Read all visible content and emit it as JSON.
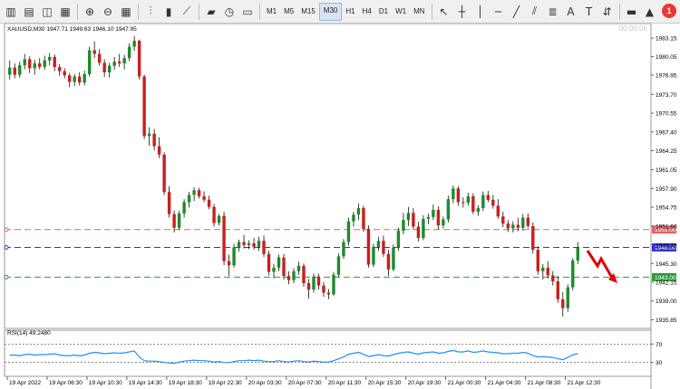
{
  "toolbar": {
    "timeframes": [
      "M1",
      "M5",
      "M15",
      "M30",
      "H1",
      "H4",
      "D1",
      "W1",
      "MN"
    ],
    "active_timeframe": "M30",
    "notification_count": "1"
  },
  "chart_data": {
    "type": "candlestick",
    "symbol_info": "XAUUSD,M30  1947.71 1949.63 1946.10 1947.95",
    "timer": "00:00:06",
    "price_axis": [
      "1983.15",
      "1980.05",
      "1976.95",
      "1973.70",
      "1970.55",
      "1967.40",
      "1964.25",
      "1961.05",
      "1957.90",
      "1954.75",
      "1951.60",
      "1948.40",
      "1945.30",
      "1942.15",
      "1939.00",
      "1935.85"
    ],
    "ylim": [
      1934.4,
      1985.6
    ],
    "time_axis": [
      "19 Apr 2022",
      "19 Apr 06:30",
      "19 Apr 10:30",
      "19 Apr 14:30",
      "19 Apr 18:30",
      "19 Apr 22:30",
      "20 Apr 03:30",
      "20 Apr 07:30",
      "20 Apr 11:30",
      "20 Apr 15:30",
      "20 Apr 19:30",
      "21 Apr 00:30",
      "21 Apr 04:30",
      "21 Apr 08:30",
      "21 Apr 12:30"
    ],
    "levels": [
      {
        "price": 1951.0,
        "label": "1951.00",
        "color": "#e06666"
      },
      {
        "price": 1948.0,
        "label": "1948.00",
        "color": "#3333cc"
      },
      {
        "price": 1943.0,
        "label": "1943.00",
        "color": "#2e9a3a"
      }
    ],
    "candles": [
      [
        1977.0,
        1979.4,
        1976.2,
        1978.2
      ],
      [
        1978.2,
        1978.9,
        1976.4,
        1977.0
      ],
      [
        1977.0,
        1979.2,
        1976.5,
        1978.6
      ],
      [
        1978.6,
        1980.5,
        1977.9,
        1979.6
      ],
      [
        1979.6,
        1980.1,
        1977.3,
        1978.1
      ],
      [
        1978.1,
        1979.5,
        1977.0,
        1978.9
      ],
      [
        1978.9,
        1979.8,
        1977.9,
        1978.3
      ],
      [
        1978.3,
        1980.2,
        1977.8,
        1979.4
      ],
      [
        1979.4,
        1980.6,
        1978.6,
        1980.0
      ],
      [
        1980.0,
        1980.4,
        1977.6,
        1978.3
      ],
      [
        1978.3,
        1978.8,
        1976.8,
        1977.6
      ],
      [
        1977.6,
        1978.1,
        1976.4,
        1976.9
      ],
      [
        1976.9,
        1977.3,
        1974.9,
        1975.8
      ],
      [
        1975.8,
        1977.1,
        1975.1,
        1976.7
      ],
      [
        1976.7,
        1977.4,
        1975.2,
        1975.7
      ],
      [
        1975.7,
        1977.7,
        1975.2,
        1977.1
      ],
      [
        1977.1,
        1981.7,
        1976.7,
        1981.1
      ],
      [
        1981.1,
        1982.6,
        1979.8,
        1980.5
      ],
      [
        1980.5,
        1981.3,
        1978.5,
        1979.0
      ],
      [
        1979.0,
        1979.6,
        1976.6,
        1977.4
      ],
      [
        1977.4,
        1979.0,
        1976.5,
        1978.5
      ],
      [
        1978.5,
        1980.0,
        1977.8,
        1979.2
      ],
      [
        1979.2,
        1980.5,
        1978.3,
        1978.9
      ],
      [
        1978.9,
        1980.3,
        1977.9,
        1979.8
      ],
      [
        1979.8,
        1982.3,
        1979.3,
        1981.7
      ],
      [
        1981.7,
        1983.5,
        1981.0,
        1982.7
      ],
      [
        1982.7,
        1982.9,
        1976.2,
        1976.7
      ],
      [
        1976.7,
        1977.0,
        1966.2,
        1966.7
      ],
      [
        1966.7,
        1968.2,
        1965.1,
        1967.1
      ],
      [
        1967.1,
        1967.9,
        1964.3,
        1965.0
      ],
      [
        1965.0,
        1966.5,
        1963.0,
        1963.6
      ],
      [
        1963.6,
        1964.0,
        1956.8,
        1957.3
      ],
      [
        1957.3,
        1958.3,
        1953.0,
        1953.6
      ],
      [
        1953.6,
        1954.2,
        1950.5,
        1951.3
      ],
      [
        1951.3,
        1954.1,
        1950.9,
        1953.7
      ],
      [
        1953.7,
        1956.1,
        1953.0,
        1955.6
      ],
      [
        1955.6,
        1957.3,
        1954.7,
        1956.8
      ],
      [
        1956.8,
        1958.1,
        1955.8,
        1957.6
      ],
      [
        1957.6,
        1958.0,
        1956.2,
        1956.6
      ],
      [
        1956.6,
        1957.4,
        1955.6,
        1956.0
      ],
      [
        1956.0,
        1956.7,
        1954.4,
        1954.8
      ],
      [
        1954.8,
        1955.3,
        1951.5,
        1952.1
      ],
      [
        1952.1,
        1953.6,
        1951.7,
        1953.3
      ],
      [
        1953.3,
        1954.0,
        1945.0,
        1945.7
      ],
      [
        1945.7,
        1946.8,
        1943.2,
        1945.0
      ],
      [
        1945.0,
        1948.6,
        1944.6,
        1948.0
      ],
      [
        1948.0,
        1949.3,
        1947.3,
        1948.9
      ],
      [
        1948.9,
        1950.1,
        1947.8,
        1948.4
      ],
      [
        1948.4,
        1949.2,
        1947.7,
        1948.7
      ],
      [
        1948.7,
        1949.6,
        1947.6,
        1948.1
      ],
      [
        1948.1,
        1949.8,
        1947.4,
        1949.1
      ],
      [
        1949.1,
        1950.0,
        1946.4,
        1946.9
      ],
      [
        1946.9,
        1947.4,
        1943.3,
        1943.9
      ],
      [
        1943.9,
        1945.2,
        1942.8,
        1944.6
      ],
      [
        1944.6,
        1946.8,
        1944.0,
        1946.3
      ],
      [
        1946.3,
        1946.9,
        1942.6,
        1943.2
      ],
      [
        1943.2,
        1944.0,
        1941.8,
        1942.5
      ],
      [
        1942.5,
        1944.5,
        1942.0,
        1944.0
      ],
      [
        1944.0,
        1945.6,
        1943.4,
        1944.9
      ],
      [
        1944.9,
        1945.3,
        1941.4,
        1942.0
      ],
      [
        1942.0,
        1942.7,
        1939.4,
        1940.9
      ],
      [
        1940.9,
        1943.6,
        1940.4,
        1943.1
      ],
      [
        1943.1,
        1943.6,
        1940.9,
        1941.6
      ],
      [
        1941.6,
        1942.2,
        1939.7,
        1940.4
      ],
      [
        1940.4,
        1941.0,
        1939.3,
        1940.1
      ],
      [
        1940.1,
        1943.9,
        1939.9,
        1943.4
      ],
      [
        1943.4,
        1947.0,
        1943.0,
        1946.5
      ],
      [
        1946.5,
        1949.4,
        1946.1,
        1948.9
      ],
      [
        1948.9,
        1953.0,
        1948.3,
        1952.4
      ],
      [
        1952.4,
        1954.0,
        1951.5,
        1953.5
      ],
      [
        1953.5,
        1955.4,
        1952.6,
        1954.6
      ],
      [
        1954.6,
        1955.0,
        1950.6,
        1951.1
      ],
      [
        1951.1,
        1951.7,
        1944.6,
        1945.1
      ],
      [
        1945.1,
        1948.6,
        1944.7,
        1948.1
      ],
      [
        1948.1,
        1949.8,
        1947.4,
        1949.1
      ],
      [
        1949.1,
        1950.0,
        1946.4,
        1946.9
      ],
      [
        1946.9,
        1947.6,
        1943.2,
        1944.3
      ],
      [
        1944.3,
        1948.5,
        1944.0,
        1948.0
      ],
      [
        1948.0,
        1951.3,
        1947.4,
        1950.8
      ],
      [
        1950.8,
        1953.8,
        1950.2,
        1952.6
      ],
      [
        1952.6,
        1954.8,
        1951.6,
        1953.8
      ],
      [
        1953.8,
        1954.6,
        1951.0,
        1951.5
      ],
      [
        1951.5,
        1952.3,
        1949.0,
        1949.6
      ],
      [
        1949.6,
        1953.4,
        1949.2,
        1952.8
      ],
      [
        1952.8,
        1953.7,
        1951.9,
        1953.1
      ],
      [
        1953.1,
        1955.2,
        1952.6,
        1954.3
      ],
      [
        1954.3,
        1954.9,
        1951.0,
        1951.7
      ],
      [
        1951.7,
        1953.2,
        1951.2,
        1952.7
      ],
      [
        1952.7,
        1956.7,
        1952.2,
        1956.1
      ],
      [
        1956.1,
        1958.4,
        1955.4,
        1957.9
      ],
      [
        1957.9,
        1958.3,
        1955.0,
        1955.6
      ],
      [
        1955.6,
        1956.4,
        1954.7,
        1955.5
      ],
      [
        1955.5,
        1957.2,
        1955.0,
        1956.6
      ],
      [
        1956.6,
        1957.1,
        1953.6,
        1954.0
      ],
      [
        1954.0,
        1955.1,
        1953.3,
        1954.6
      ],
      [
        1954.6,
        1957.4,
        1954.1,
        1956.8
      ],
      [
        1956.8,
        1957.5,
        1955.6,
        1956.0
      ],
      [
        1956.0,
        1956.8,
        1954.5,
        1955.0
      ],
      [
        1955.0,
        1956.1,
        1952.8,
        1953.2
      ],
      [
        1953.2,
        1954.0,
        1951.4,
        1952.0
      ],
      [
        1952.0,
        1952.6,
        1950.6,
        1951.2
      ],
      [
        1951.2,
        1952.4,
        1950.5,
        1951.8
      ],
      [
        1951.8,
        1953.0,
        1950.7,
        1951.3
      ],
      [
        1951.3,
        1953.6,
        1950.8,
        1953.0
      ],
      [
        1953.0,
        1953.7,
        1951.2,
        1951.6
      ],
      [
        1951.6,
        1952.2,
        1947.0,
        1947.6
      ],
      [
        1947.6,
        1948.2,
        1943.4,
        1944.0
      ],
      [
        1944.0,
        1945.2,
        1942.6,
        1944.6
      ],
      [
        1944.6,
        1945.7,
        1942.8,
        1943.3
      ],
      [
        1943.3,
        1944.0,
        1941.6,
        1942.3
      ],
      [
        1942.3,
        1943.2,
        1938.7,
        1939.3
      ],
      [
        1939.3,
        1940.5,
        1936.4,
        1937.8
      ],
      [
        1937.8,
        1941.8,
        1937.2,
        1941.3
      ],
      [
        1941.3,
        1946.2,
        1940.8,
        1945.8
      ],
      [
        1945.8,
        1948.9,
        1945.2,
        1947.95
      ]
    ],
    "rsi": {
      "label": "RSI(14) 49.2480",
      "levels": [
        "70",
        "30"
      ],
      "range": [
        0,
        100
      ],
      "values": [
        46,
        46,
        45,
        47,
        48,
        46,
        47,
        47,
        48,
        49,
        46,
        45,
        45,
        46,
        45,
        46,
        50,
        52,
        51,
        49,
        50,
        51,
        50,
        51,
        53,
        55,
        42,
        34,
        33,
        33,
        32,
        30,
        29,
        28,
        31,
        33,
        34,
        35,
        34,
        34,
        33,
        31,
        32,
        30,
        30,
        32,
        34,
        34,
        35,
        34,
        35,
        33,
        32,
        32,
        34,
        32,
        31,
        33,
        34,
        32,
        31,
        33,
        32,
        31,
        31,
        34,
        38,
        42,
        48,
        50,
        52,
        48,
        43,
        45,
        47,
        45,
        44,
        47,
        50,
        52,
        53,
        50,
        48,
        51,
        52,
        53,
        50,
        51,
        54,
        56,
        53,
        53,
        55,
        52,
        53,
        55,
        53,
        52,
        51,
        49,
        49,
        50,
        50,
        52,
        50,
        45,
        42,
        43,
        42,
        41,
        38,
        36,
        41,
        47,
        49
      ]
    }
  }
}
